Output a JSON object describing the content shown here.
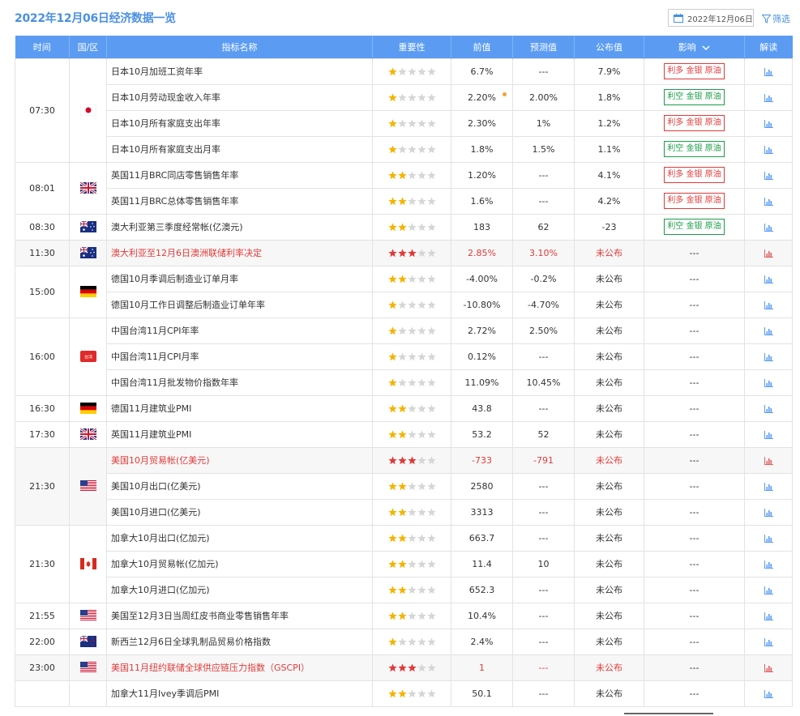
{
  "header": {
    "title": "2022年12月06日经济数据一览",
    "date": "2022年12月06日",
    "filter_label": "筛选"
  },
  "columns": [
    "时间",
    "国/区",
    "指标名称",
    "重要性",
    "前值",
    "预测值",
    "公布值",
    "影响",
    "解读"
  ],
  "impact_dropdown_icon": "chevron-down-icon",
  "colors": {
    "header_bg": "#5b9cf2",
    "accent": "#4a90e2",
    "bear": "#e03a3a",
    "bull": "#1a9d48",
    "star_on": "#f5b400",
    "star_hl": "#e03a3a",
    "star_off": "#d6d6d6"
  },
  "groups": [
    {
      "time": "07:30",
      "flag": "japan-flag-icon",
      "rows": [
        {
          "name": "日本10月加班工资年率",
          "stars": 1,
          "prev": "6.7%",
          "forecast": "---",
          "actual": "7.9%",
          "impact": "利多 金银 原油",
          "impact_type": "bear"
        },
        {
          "name": "日本10月劳动现金收入年率",
          "stars": 1,
          "prev": "2.20%",
          "forecast": "2.00%",
          "actual": "1.8%",
          "impact": "利空 金银 原油",
          "impact_type": "bull"
        },
        {
          "name": "日本10月所有家庭支出年率",
          "stars": 1,
          "prev": "2.30%",
          "forecast": "1%",
          "actual": "1.2%",
          "impact": "利多 金银 原油",
          "impact_type": "bear"
        },
        {
          "name": "日本10月所有家庭支出月率",
          "stars": 1,
          "prev": "1.8%",
          "forecast": "1.5%",
          "actual": "1.1%",
          "impact": "利空 金银 原油",
          "impact_type": "bull"
        }
      ]
    },
    {
      "time": "08:01",
      "flag": "uk-flag-icon",
      "rows": [
        {
          "name": "英国11月BRC同店零售销售年率",
          "stars": 2,
          "prev": "1.20%",
          "forecast": "---",
          "actual": "4.1%",
          "impact": "利多 金银 原油",
          "impact_type": "bear"
        },
        {
          "name": "英国11月BRC总体零售销售年率",
          "stars": 2,
          "prev": "1.6%",
          "forecast": "---",
          "actual": "4.2%",
          "impact": "利多 金银 原油",
          "impact_type": "bear"
        }
      ]
    },
    {
      "time": "08:30",
      "flag": "australia-flag-icon",
      "rows": [
        {
          "name": "澳大利亚第三季度经常帐(亿澳元)",
          "stars": 2,
          "prev": "183",
          "forecast": "62",
          "actual": "-23",
          "impact": "利空 金银 原油",
          "impact_type": "bull"
        }
      ]
    },
    {
      "time": "11:30",
      "flag": "australia-flag-icon",
      "rows": [
        {
          "name": "澳大利亚至12月6日澳洲联储利率决定",
          "stars": 3,
          "prev": "2.85%",
          "forecast": "3.10%",
          "actual": "未公布",
          "impact": "---",
          "impact_type": "none",
          "highlight": true
        }
      ]
    },
    {
      "time": "15:00",
      "flag": "germany-flag-icon",
      "rows": [
        {
          "name": "德国10月季调后制造业订单月率",
          "stars": 2,
          "prev": "-4.00%",
          "forecast": "-0.2%",
          "actual": "未公布",
          "impact": "---",
          "impact_type": "none"
        },
        {
          "name": "德国10月工作日调整后制造业订单年率",
          "stars": 1,
          "prev": "-10.80%",
          "forecast": "-4.70%",
          "actual": "未公布",
          "impact": "---",
          "impact_type": "none"
        }
      ]
    },
    {
      "time": "16:00",
      "flag": "taiwan-flag-icon",
      "rows": [
        {
          "name": "中国台湾11月CPI年率",
          "stars": 1,
          "prev": "2.72%",
          "forecast": "2.50%",
          "actual": "未公布",
          "impact": "---",
          "impact_type": "none"
        },
        {
          "name": "中国台湾11月CPI月率",
          "stars": 1,
          "prev": "0.12%",
          "forecast": "---",
          "actual": "未公布",
          "impact": "---",
          "impact_type": "none"
        },
        {
          "name": "中国台湾11月批发物价指数年率",
          "stars": 1,
          "prev": "11.09%",
          "forecast": "10.45%",
          "actual": "未公布",
          "impact": "---",
          "impact_type": "none"
        }
      ]
    },
    {
      "time": "16:30",
      "flag": "germany-flag-icon",
      "rows": [
        {
          "name": "德国11月建筑业PMI",
          "stars": 2,
          "prev": "43.8",
          "forecast": "---",
          "actual": "未公布",
          "impact": "---",
          "impact_type": "none"
        }
      ]
    },
    {
      "time": "17:30",
      "flag": "uk-flag-icon",
      "rows": [
        {
          "name": "英国11月建筑业PMI",
          "stars": 2,
          "prev": "53.2",
          "forecast": "52",
          "actual": "未公布",
          "impact": "---",
          "impact_type": "none"
        }
      ]
    },
    {
      "time": "21:30",
      "flag": "us-flag-icon",
      "rows": [
        {
          "name": "美国10月贸易帐(亿美元)",
          "stars": 3,
          "prev": "-733",
          "forecast": "-791",
          "actual": "未公布",
          "impact": "---",
          "impact_type": "none",
          "highlight": true
        },
        {
          "name": "美国10月出口(亿美元)",
          "stars": 2,
          "prev": "2580",
          "forecast": "---",
          "actual": "未公布",
          "impact": "---",
          "impact_type": "none"
        },
        {
          "name": "美国10月进口(亿美元)",
          "stars": 2,
          "prev": "3313",
          "forecast": "---",
          "actual": "未公布",
          "impact": "---",
          "impact_type": "none"
        }
      ]
    },
    {
      "time": "21:30",
      "flag": "canada-flag-icon",
      "rows": [
        {
          "name": "加拿大10月出口(亿加元)",
          "stars": 2,
          "prev": "663.7",
          "forecast": "---",
          "actual": "未公布",
          "impact": "---",
          "impact_type": "none"
        },
        {
          "name": "加拿大10月贸易帐(亿加元)",
          "stars": 2,
          "prev": "11.4",
          "forecast": "10",
          "actual": "未公布",
          "impact": "---",
          "impact_type": "none"
        },
        {
          "name": "加拿大10月进口(亿加元)",
          "stars": 2,
          "prev": "652.3",
          "forecast": "---",
          "actual": "未公布",
          "impact": "---",
          "impact_type": "none"
        }
      ]
    },
    {
      "time": "21:55",
      "flag": "us-flag-icon",
      "rows": [
        {
          "name": "美国至12月3日当周红皮书商业零售销售年率",
          "stars": 2,
          "prev": "10.4%",
          "forecast": "---",
          "actual": "未公布",
          "impact": "---",
          "impact_type": "none"
        }
      ]
    },
    {
      "time": "22:00",
      "flag": "newzealand-flag-icon",
      "rows": [
        {
          "name": "新西兰12月6日全球乳制品贸易价格指数",
          "stars": 1,
          "prev": "2.4%",
          "forecast": "---",
          "actual": "未公布",
          "impact": "---",
          "impact_type": "none"
        }
      ]
    },
    {
      "time": "23:00",
      "flag": "us-flag-icon",
      "rows": [
        {
          "name": "美国11月纽约联储全球供应链压力指数（GSCPI）",
          "stars": 3,
          "prev": "1",
          "forecast": "---",
          "actual": "未公布",
          "impact": "---",
          "impact_type": "none",
          "highlight": true
        }
      ]
    },
    {
      "time": "",
      "flag": "",
      "rows": [
        {
          "name": "加拿大11月Ivey季调后PMI",
          "stars": 2,
          "prev": "50.1",
          "forecast": "---",
          "actual": "未公布",
          "impact": "---",
          "impact_type": "none"
        }
      ]
    }
  ]
}
